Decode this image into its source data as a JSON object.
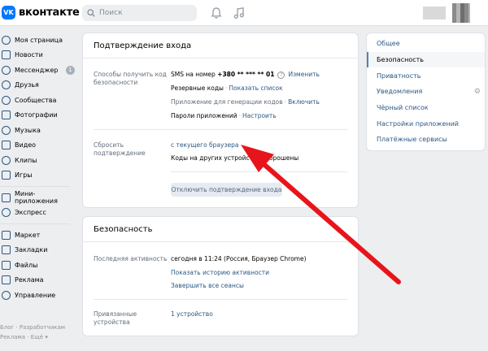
{
  "header": {
    "logo_mark": "VK",
    "logo_text": "вконтакте",
    "search_placeholder": "Поиск"
  },
  "left_nav": {
    "items": [
      {
        "label": "Моя страница",
        "icon": "user-icon"
      },
      {
        "label": "Новости",
        "icon": "news-icon"
      },
      {
        "label": "Мессенджер",
        "icon": "chat-icon",
        "badge": "1"
      },
      {
        "label": "Друзья",
        "icon": "friends-icon"
      },
      {
        "label": "Сообщества",
        "icon": "groups-icon"
      },
      {
        "label": "Фотографии",
        "icon": "photo-icon"
      },
      {
        "label": "Музыка",
        "icon": "music-icon"
      },
      {
        "label": "Видео",
        "icon": "video-icon"
      },
      {
        "label": "Клипы",
        "icon": "clips-icon"
      },
      {
        "label": "Игры",
        "icon": "games-icon"
      },
      {
        "label": "Мини-приложения",
        "icon": "apps-icon"
      },
      {
        "label": "Экспресс",
        "icon": "express-icon"
      },
      {
        "label": "Маркет",
        "icon": "market-icon"
      },
      {
        "label": "Закладки",
        "icon": "bookmarks-icon"
      },
      {
        "label": "Файлы",
        "icon": "files-icon"
      },
      {
        "label": "Реклама",
        "icon": "ads-icon"
      },
      {
        "label": "Управление",
        "icon": "manage-icon"
      }
    ],
    "footer_line1": "Блог · Разработчикам",
    "footer_line2": "Реклама · Ещё ▾"
  },
  "login_panel": {
    "title": "Подтверждение входа",
    "methods_label": "Способы получить код безопасности",
    "sms_prefix": "SMS на номер ",
    "sms_number": "+380 ** *** ** 01",
    "help": "?",
    "change_link": "Изменить",
    "backup_label": "Резервные коды",
    "backup_link": "Показать список",
    "generator_label": "Приложение для генерации кодов",
    "generator_link": "Включить",
    "app_passwords_label": "Пароли приложений",
    "app_passwords_link": "Настроить",
    "reset_label": "Сбросить подтверждение",
    "reset_link": "с текущего браузера",
    "reset_note": "Коды на других устройствах сброшены",
    "disable_button": "Отключить подтверждение входа"
  },
  "security_panel": {
    "title": "Безопасность",
    "last_activity_label": "Последняя активность",
    "last_activity_value": "сегодня в 11:24 (Россия, Браузер Chrome)",
    "show_history_link": "Показать историю активности",
    "end_sessions_link": "Завершить все сеансы",
    "devices_label": "Привязанные устройства",
    "devices_link": "1 устройство"
  },
  "settings_menu": {
    "items": [
      {
        "label": "Общее",
        "active": false
      },
      {
        "label": "Безопасность",
        "active": true
      },
      {
        "label": "Приватность",
        "active": false
      },
      {
        "label": "Уведомления",
        "active": false,
        "gear": "gear-icon"
      },
      {
        "label": "Чёрный список",
        "active": false
      },
      {
        "label": "Настройки приложений",
        "active": false
      },
      {
        "label": "Платёжные сервисы",
        "active": false
      }
    ]
  },
  "colors": {
    "accent": "#0077ff",
    "link": "#2a5885",
    "annotation_arrow": "#e8141b",
    "background": "#edeef0"
  }
}
